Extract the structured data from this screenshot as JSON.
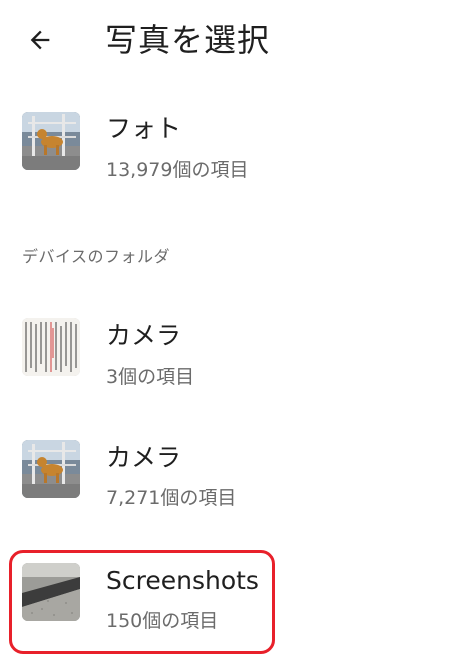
{
  "header": {
    "back_icon": "arrow-back-icon",
    "title": "写真を選択"
  },
  "photos": {
    "title": "フォト",
    "count": "13,979個の項目"
  },
  "device_section": {
    "label": "デバイスのフォルダ"
  },
  "folders": [
    {
      "title": "カメラ",
      "count": "3個の項目"
    },
    {
      "title": "カメラ",
      "count": "7,271個の項目"
    },
    {
      "title": "Screenshots",
      "count": "150個の項目"
    }
  ],
  "colors": {
    "highlight": "#e8202a",
    "secondary_text": "#6b6b6b"
  }
}
